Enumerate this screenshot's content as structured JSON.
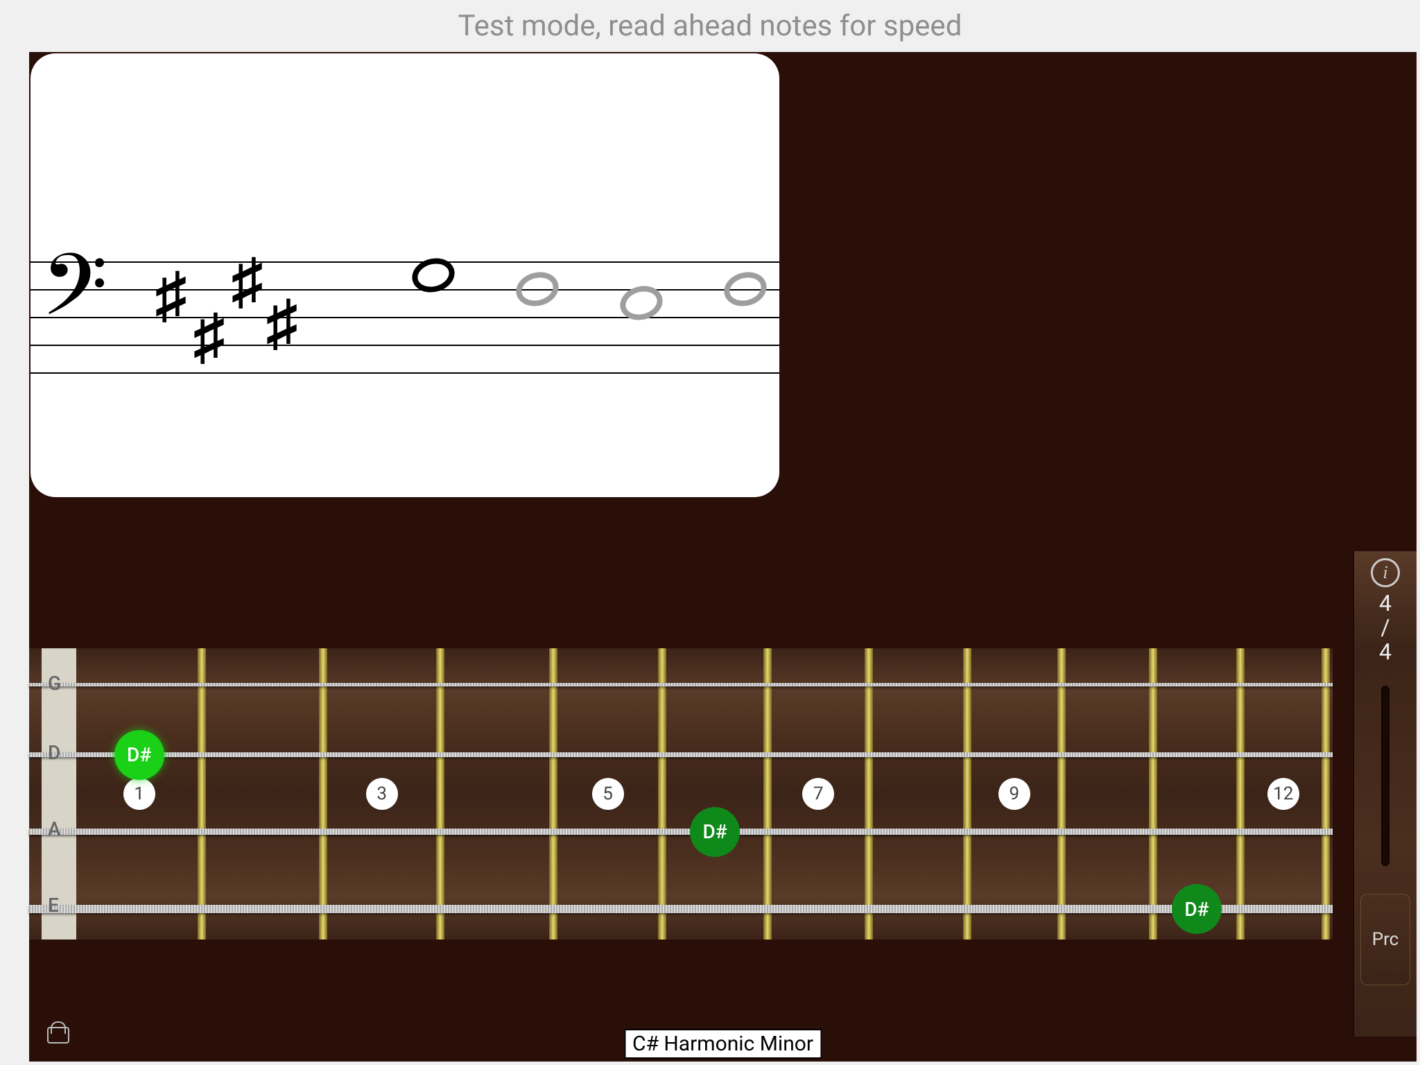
{
  "header": {
    "title": "Test mode, read ahead notes for speed"
  },
  "staff": {
    "clef": "bass",
    "key_sharps": 4,
    "notes": [
      {
        "pos": 3,
        "active": true
      },
      {
        "pos": 2,
        "active": false
      },
      {
        "pos": 1,
        "active": false
      },
      {
        "pos": 2,
        "active": false
      }
    ]
  },
  "fretboard": {
    "strings": [
      "G",
      "D",
      "A",
      "E"
    ],
    "markers": [
      {
        "fret": 1,
        "label": "1"
      },
      {
        "fret": 3,
        "label": "3"
      },
      {
        "fret": 5,
        "label": "5"
      },
      {
        "fret": 7,
        "label": "7"
      },
      {
        "fret": 9,
        "label": "9"
      },
      {
        "fret": 12,
        "label": "12"
      }
    ],
    "notes": [
      {
        "string": 1,
        "fret": 1,
        "label": "D#",
        "style": "bright"
      },
      {
        "string": 2,
        "fret": 6,
        "label": "D#",
        "style": "dark"
      },
      {
        "string": 3,
        "fret": 11,
        "label": "D#",
        "style": "dark"
      }
    ],
    "fret_count": 12
  },
  "sidebar": {
    "time_signature": {
      "top": "4",
      "sep": "/",
      "bottom": "4"
    },
    "button": "Prc"
  },
  "scale": {
    "name": "C# Harmonic Minor"
  }
}
